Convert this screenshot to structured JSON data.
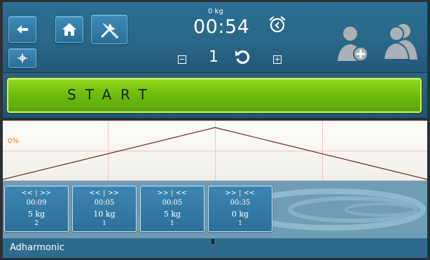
{
  "header": {
    "back_icon": "arrow-left-icon",
    "home_icon": "home-icon",
    "tools_icon": "tools-icon",
    "target_icon": "crosshair-icon",
    "weight": "0 kg",
    "timer": "00:54",
    "alarm_icon": "alarm-clock-icon",
    "minus_label": "−",
    "plus_label": "+",
    "repetitions": "1",
    "repeat_icon": "repeat-icon",
    "user_add_icon": "user-add-icon",
    "users_icon": "users-icon"
  },
  "start": {
    "label": "START"
  },
  "graph": {
    "percent_label": "0%",
    "profile": [
      {
        "t": 0,
        "v": 0
      },
      {
        "t": 0.5,
        "v": 1
      },
      {
        "t": 1,
        "v": 0
      }
    ]
  },
  "segments": [
    {
      "direction": "<< | >>",
      "time": "00:09",
      "weight": "5 kg",
      "reps": "2"
    },
    {
      "direction": "<< | >>",
      "time": "00:05",
      "weight": "10 kg",
      "reps": "1"
    },
    {
      "direction": ">> | <<",
      "time": "00:05",
      "weight": "5 kg",
      "reps": "1"
    },
    {
      "direction": ">> | <<",
      "time": "00:35",
      "weight": "0 kg",
      "reps": "1"
    }
  ],
  "footer": {
    "mode": "Adharmonic"
  },
  "colors": {
    "header_blue": "#2a6788",
    "start_green": "#6fbe0c",
    "graph_line": "#6b2a1f",
    "percent_orange": "#ff7d12",
    "segment_blue": "#3478a3"
  }
}
